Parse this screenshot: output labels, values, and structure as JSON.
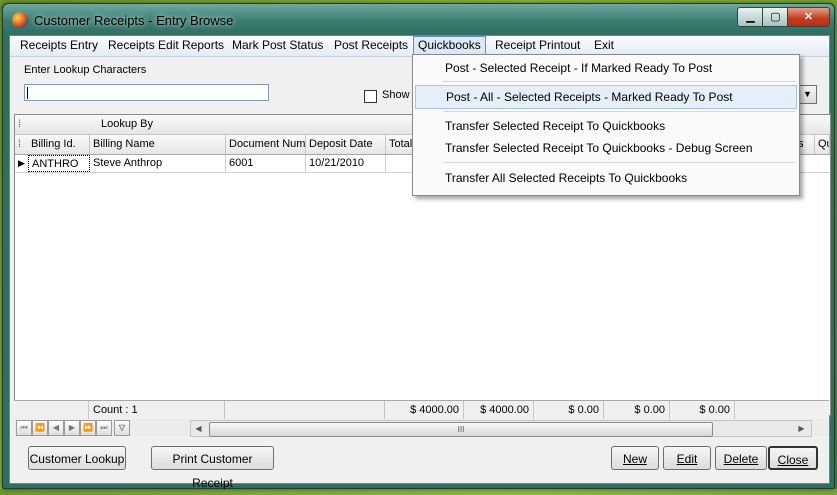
{
  "window": {
    "title": "Customer Receipts - Entry Browse"
  },
  "window_controls": {
    "minimize": "▁",
    "maximize": "▢",
    "close": "✕"
  },
  "menu": {
    "items": [
      "Receipts Entry",
      "Receipts Edit Reports",
      "Mark Post Status",
      "Post Receipts",
      "Quickbooks",
      "Receipt Printout",
      "Exit"
    ],
    "active": "Quickbooks"
  },
  "dropdown": {
    "items": [
      "Post - Selected Receipt - If Marked Ready To Post",
      "Post - All - Selected Receipts - Marked Ready To Post",
      "Transfer Selected Receipt To Quickbooks",
      "Transfer Selected Receipt To Quickbooks - Debug Screen",
      "Transfer All Selected Receipts To Quickbooks"
    ],
    "highlighted": 1
  },
  "lookup": {
    "label": "Enter Lookup Characters",
    "value": "",
    "show_label": "Show"
  },
  "grid": {
    "lookup_by_label": "Lookup By",
    "columns": [
      "Billing Id.",
      "Billing Name",
      "Document Num",
      "Deposit Date",
      "Total",
      "s",
      "Qu"
    ],
    "rows": [
      {
        "billing_id": "ANTHRO",
        "billing_name": "Steve Anthrop",
        "document_num": "6001",
        "deposit_date": "10/21/2010"
      }
    ],
    "footer": {
      "count": "Count : 1",
      "totals": [
        "$ 4000.00",
        "$ 4000.00",
        "$ 0.00",
        "$ 0.00",
        "$ 0.00"
      ]
    }
  },
  "icons": {
    "row_indicator": "▶",
    "grip": "⁞",
    "nav_first": "⏮",
    "nav_prev_page": "⏪",
    "nav_prev": "◀",
    "nav_next": "▶",
    "nav_next_page": "⏩",
    "nav_last": "⏭",
    "filter": "▽",
    "scroll_left": "◀",
    "scroll_right": "▶",
    "scroll_grip": "III",
    "combo_arrow": "▼"
  },
  "buttons": {
    "customer_lookup": "Customer Lookup",
    "print_receipt": "Print Customer Receipt",
    "new": "New",
    "edit": "Edit",
    "delete": "Delete",
    "close": "Close"
  }
}
